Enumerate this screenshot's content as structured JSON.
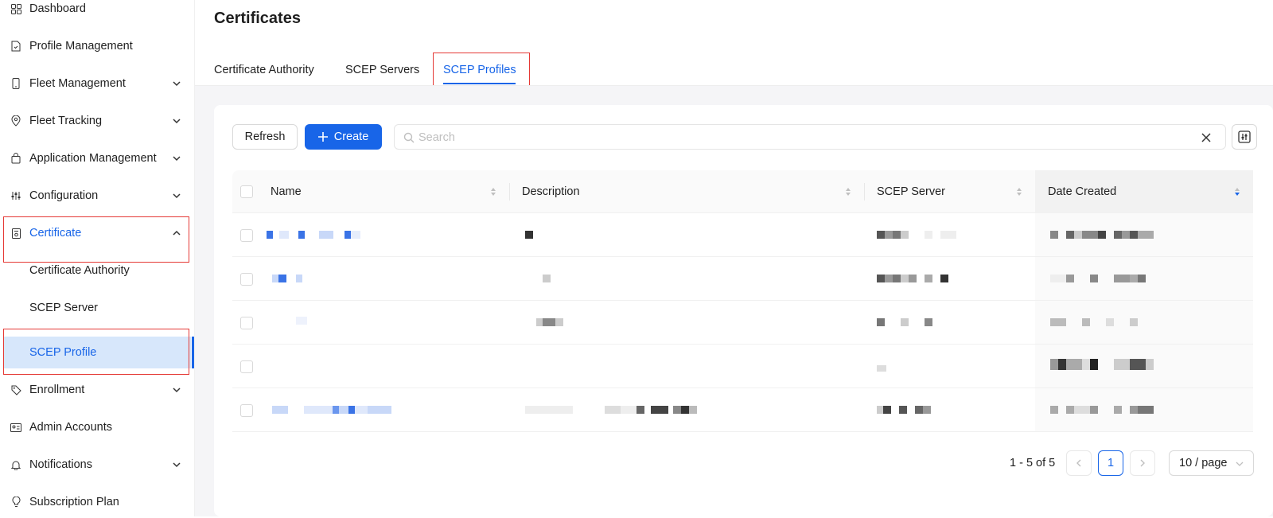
{
  "sidebar": {
    "items": [
      {
        "label": "Dashboard",
        "icon": "dashboard-icon"
      },
      {
        "label": "Profile Management",
        "icon": "file-icon"
      },
      {
        "label": "Fleet Management",
        "icon": "phone-icon"
      },
      {
        "label": "Fleet Tracking",
        "icon": "location-pin-icon"
      },
      {
        "label": "Application Management",
        "icon": "shopping-bag-icon"
      },
      {
        "label": "Configuration",
        "icon": "sliders-icon"
      },
      {
        "label": "Certificate",
        "icon": "certificate-icon"
      },
      {
        "label": "Certificate Authority"
      },
      {
        "label": "SCEP Server"
      },
      {
        "label": "SCEP Profile"
      },
      {
        "label": "Enrollment",
        "icon": "tag-icon"
      },
      {
        "label": "Admin Accounts",
        "icon": "id-card-icon"
      },
      {
        "label": "Notifications",
        "icon": "bell-icon"
      },
      {
        "label": "Subscription Plan",
        "icon": "bulb-icon"
      }
    ]
  },
  "header": {
    "title": "Certificates"
  },
  "tabs": [
    {
      "label": "Certificate Authority"
    },
    {
      "label": "SCEP Servers"
    },
    {
      "label": "SCEP Profiles"
    }
  ],
  "toolbar": {
    "refresh_label": "Refresh",
    "create_label": "Create",
    "search_placeholder": "Search"
  },
  "table": {
    "columns": [
      "Name",
      "Description",
      "SCEP Server",
      "Date Created"
    ]
  },
  "pagination": {
    "range": "1 - 5 of 5",
    "current_page": "1",
    "page_size": "10 / page"
  },
  "colors": {
    "accent": "#1865e8",
    "selected_bg": "#d7e7fb",
    "highlight_box": "#e53935"
  }
}
